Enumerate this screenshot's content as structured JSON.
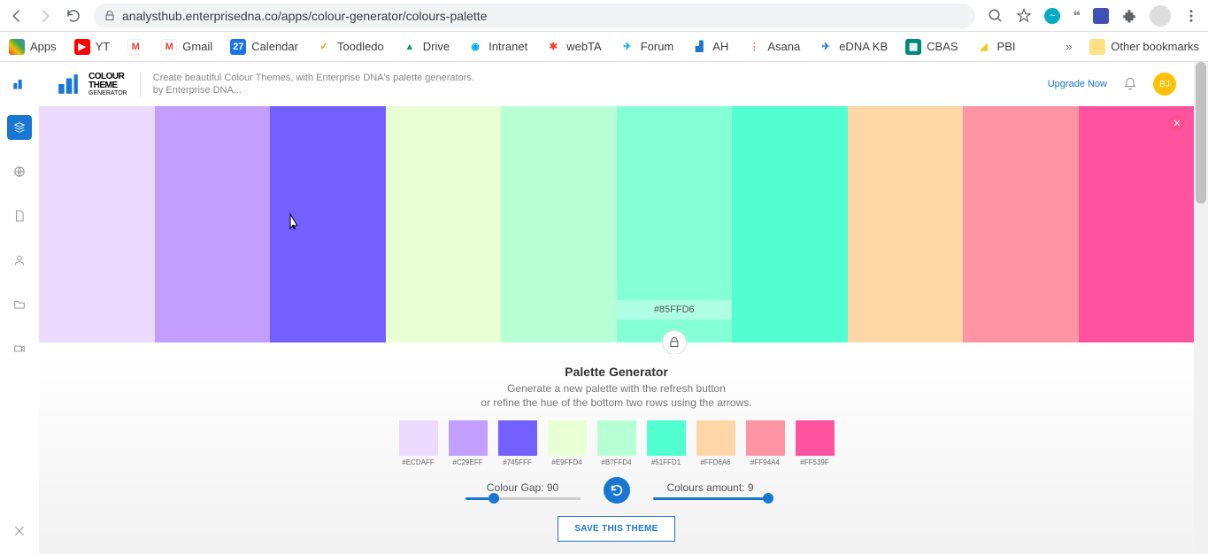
{
  "browser": {
    "url": "analysthub.enterprisedna.co/apps/colour-generator/colours-palette",
    "bookmarks": [
      {
        "label": "Apps",
        "icon_color": "#ffffff"
      },
      {
        "label": "YT",
        "icon_color": "#ff0000"
      },
      {
        "label": "",
        "icon_color": "#ea4335"
      },
      {
        "label": "Gmail",
        "icon_color": "#ea4335"
      },
      {
        "label": "Calendar",
        "icon_color": "#1a73e8"
      },
      {
        "label": "Toodledo",
        "icon_color": "#ff9800"
      },
      {
        "label": "Drive",
        "icon_color": "#0f9d58"
      },
      {
        "label": "Intranet",
        "icon_color": "#03a9f4"
      },
      {
        "label": "webTA",
        "icon_color": "#f44336"
      },
      {
        "label": "Forum",
        "icon_color": "#03a9f4"
      },
      {
        "label": "AH",
        "icon_color": "#1976d2"
      },
      {
        "label": "Asana",
        "icon_color": "#f06a6a"
      },
      {
        "label": "eDNA KB",
        "icon_color": "#1976d2"
      },
      {
        "label": "CBAS",
        "icon_color": "#00897b"
      },
      {
        "label": "PBI",
        "icon_color": "#f2c811"
      }
    ],
    "other_bookmarks": "Other bookmarks"
  },
  "app": {
    "brand": {
      "line1": "COLOUR",
      "line2": "THEME",
      "sub": "GENERATOR"
    },
    "tagline1": "Create beautiful Colour Themes, with Enterprise DNA's palette generators.",
    "tagline2": "by Enterprise DNA...",
    "upgrade": "Upgrade Now",
    "avatar_initials": "BJ"
  },
  "palette": {
    "colors": [
      {
        "hex": "#ECDAFF"
      },
      {
        "hex": "#C29EFF"
      },
      {
        "hex": "#745FFF"
      },
      {
        "hex": "#E9FFD4"
      },
      {
        "hex": "#B7FFD4"
      },
      {
        "hex": "#85FFD6",
        "show_label": true,
        "locked": true
      },
      {
        "hex": "#51FFD1"
      },
      {
        "hex": "#FFD6A6"
      },
      {
        "hex": "#FF94A4"
      },
      {
        "hex": "#FF539F"
      }
    ],
    "selected_hex_label": "#85FFD6"
  },
  "generator": {
    "title": "Palette Generator",
    "desc1": "Generate a new palette with the refresh button",
    "desc2": "or refine the hue of the bottom two rows using the arrows.",
    "mini": [
      {
        "hex": "#ECDAFF"
      },
      {
        "hex": "#C29EFF"
      },
      {
        "hex": "#745FFF"
      },
      {
        "hex": "#E9FFD4"
      },
      {
        "hex": "#B7FFD4"
      },
      {
        "hex": "#51FFD1"
      },
      {
        "hex": "#FFD6A6"
      },
      {
        "hex": "#FF94A4"
      },
      {
        "hex": "#FF539F"
      }
    ],
    "gap_label": "Colour Gap: 90",
    "gap_pct": 25,
    "amount_label": "Colours amount: 9",
    "amount_pct": 100,
    "save_label": "SAVE THIS THEME"
  }
}
